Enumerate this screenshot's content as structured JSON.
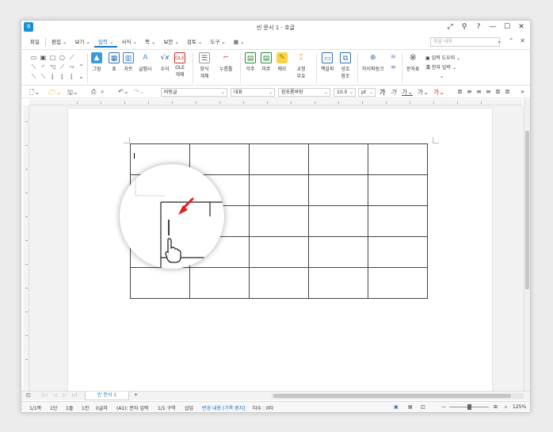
{
  "window": {
    "title": "빈 문서 1 - 호글"
  },
  "menus": [
    "파일",
    "편집",
    "보기",
    "입력",
    "서식",
    "쪽",
    "보안",
    "검토",
    "도구"
  ],
  "active_menu": "입력",
  "search_placeholder": "찾을 내용",
  "ribbon": {
    "picture": "그림",
    "table": "표",
    "chart": "차트",
    "clipart": "글맵시",
    "formula": "수식",
    "ole": "OLE\n개체",
    "field": "양식\n개체",
    "footnote": "누름틀",
    "endnote": "각주",
    "tailnote": "미주",
    "memo": "메모",
    "annot": "교정\n부호",
    "bookmark": "책갈피",
    "cross": "상호\n참조",
    "hyperlink": "하이퍼링크",
    "symbol": "문자표",
    "input_tool": "입력 도우미",
    "hanja": "한자 입력"
  },
  "toolbar": {
    "style": "바탕글",
    "lang": "대표",
    "font": "함초롬바탕",
    "size": "10.0",
    "unit": "pt"
  },
  "tabs": {
    "doc_tab": "빈 문서 1"
  },
  "status": {
    "page": "1/1쪽",
    "column": "1단",
    "line": "1줄",
    "col": "1칸",
    "chars": "0글자",
    "cell": "(A1): 문자 입력",
    "section": "1/1 구역",
    "insert": "삽입",
    "track": "변경 내용 [기록 중지]",
    "typo": "타수 : 0타",
    "zoom": "125%"
  },
  "colors": {
    "accent": "#1a73c8",
    "arrow": "#e02020"
  }
}
